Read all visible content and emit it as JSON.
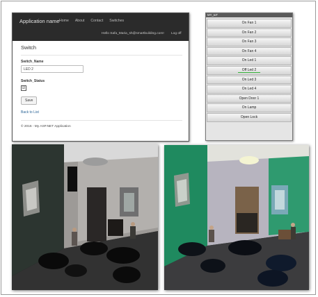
{
  "asp": {
    "brand": "Application name",
    "nav": [
      "Home",
      "About",
      "Contact",
      "Switches"
    ],
    "hello": "Hello Safa_Maria_sh@smartbuilding.com!",
    "logoff": "Log off",
    "heading": "Switch",
    "switch_name_label": "Switch_Name",
    "switch_name_value": "LED 2",
    "switch_status_label": "Switch_Status",
    "checkbox_mark": "☑",
    "save_label": "Save",
    "back_label": "Back to List",
    "footer": "© 2016 - My ASP.NET Application"
  },
  "iot": {
    "title": "MY_IoT",
    "buttons": [
      "On Fan 1",
      "On Fan 2",
      "On Fan 3",
      "On Fan 4",
      "On Led 1",
      "Off Led 2",
      "On Led 3",
      "On Led 4",
      "Open Door 1",
      "On Lamp",
      "Open Lock"
    ],
    "highlight_color": "#36b33a"
  },
  "photos": [
    "living-room-model-dark",
    "living-room-model-green"
  ]
}
